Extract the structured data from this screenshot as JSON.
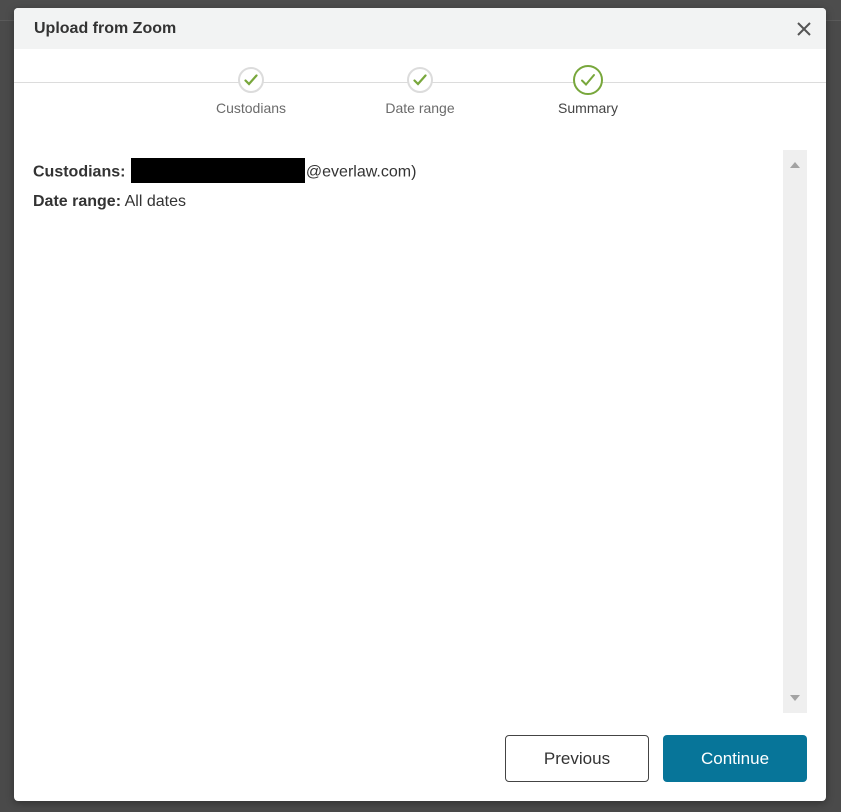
{
  "dialog": {
    "title": "Upload from Zoom",
    "close_icon": "close-icon"
  },
  "steps": [
    {
      "label": "Custodians",
      "status": "complete",
      "icon": "check-icon"
    },
    {
      "label": "Date range",
      "status": "complete",
      "icon": "check-icon"
    },
    {
      "label": "Summary",
      "status": "current",
      "icon": "check-icon"
    }
  ],
  "summary": {
    "custodians_label": "Custodians:",
    "custodians_value_suffix": "@everlaw.com)",
    "custodians_redacted": true,
    "date_range_label": "Date range:",
    "date_range_value": "All dates"
  },
  "footer": {
    "previous_label": "Previous",
    "continue_label": "Continue"
  },
  "colors": {
    "accent": "#077599",
    "success": "#78a73c",
    "header_bg": "#f2f3f3"
  }
}
